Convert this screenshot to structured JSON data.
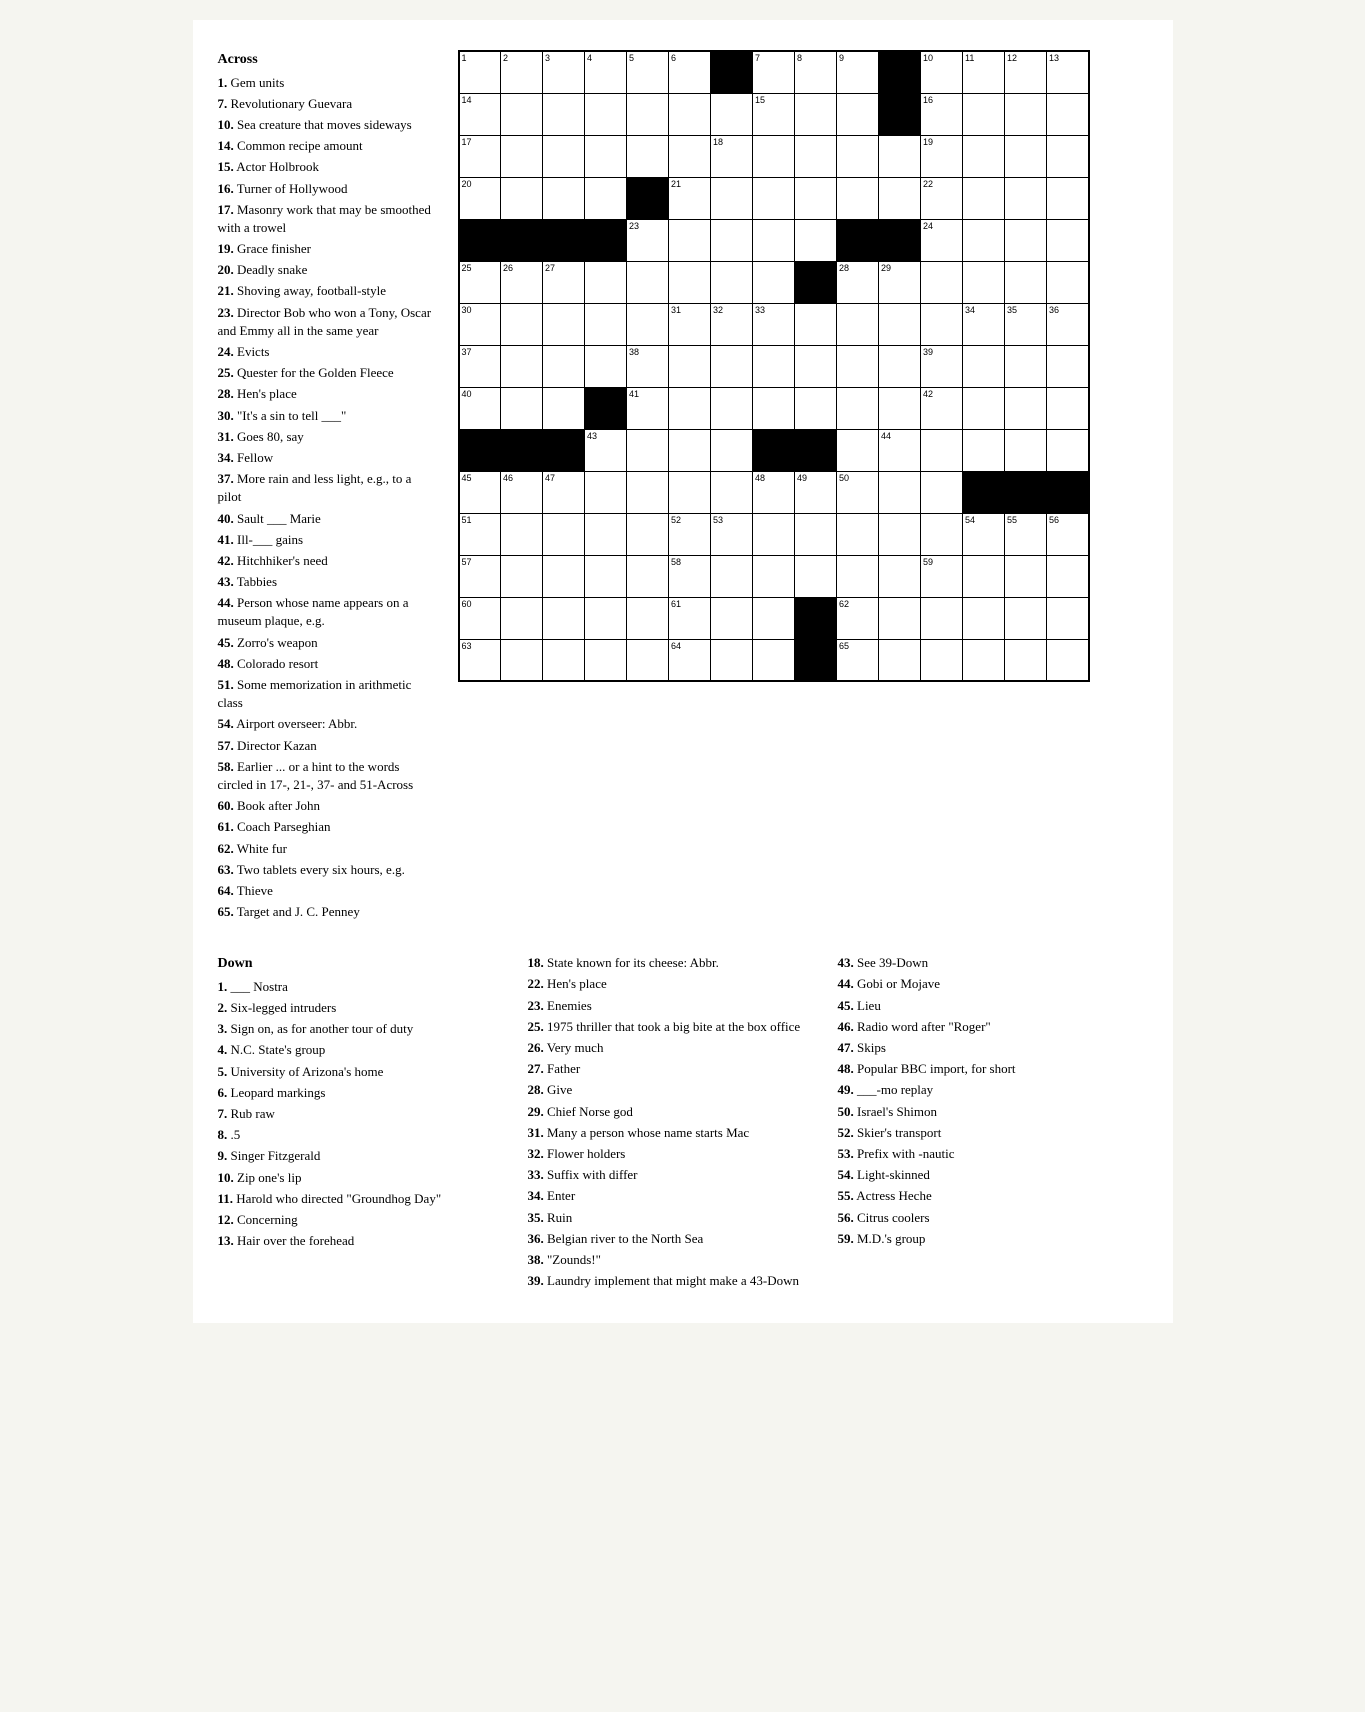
{
  "across_title": "Across",
  "down_title": "Down",
  "across_clues": [
    {
      "num": "1",
      "text": "Gem units"
    },
    {
      "num": "7",
      "text": "Revolutionary Guevara"
    },
    {
      "num": "10",
      "text": "Sea creature that moves sideways"
    },
    {
      "num": "14",
      "text": "Common recipe amount"
    },
    {
      "num": "15",
      "text": "Actor Holbrook"
    },
    {
      "num": "16",
      "text": "Turner of Hollywood"
    },
    {
      "num": "17",
      "text": "Masonry work that may be smoothed with a trowel"
    },
    {
      "num": "19",
      "text": "Grace finisher"
    },
    {
      "num": "20",
      "text": "Deadly snake"
    },
    {
      "num": "21",
      "text": "Shoving away, football-style"
    },
    {
      "num": "23",
      "text": "Director Bob who won a Tony, Oscar and Emmy all in the same year"
    },
    {
      "num": "24",
      "text": "Evicts"
    },
    {
      "num": "25",
      "text": "Quester for the Golden Fleece"
    },
    {
      "num": "28",
      "text": "Hen's place"
    },
    {
      "num": "30",
      "text": "\"It's a sin to tell ___\""
    },
    {
      "num": "31",
      "text": "Goes 80, say"
    },
    {
      "num": "34",
      "text": "Fellow"
    },
    {
      "num": "37",
      "text": "More rain and less light, e.g., to a pilot"
    },
    {
      "num": "40",
      "text": "Sault ___ Marie"
    },
    {
      "num": "41",
      "text": "Ill-___ gains"
    },
    {
      "num": "42",
      "text": "Hitchhiker's need"
    },
    {
      "num": "43",
      "text": "Tabbies"
    },
    {
      "num": "44",
      "text": "Person whose name appears on a museum plaque, e.g."
    },
    {
      "num": "45",
      "text": "Zorro's weapon"
    },
    {
      "num": "48",
      "text": "Colorado resort"
    },
    {
      "num": "51",
      "text": "Some memorization in arithmetic class"
    },
    {
      "num": "54",
      "text": "Airport overseer: Abbr."
    },
    {
      "num": "57",
      "text": "Director Kazan"
    },
    {
      "num": "58",
      "text": "Earlier ... or a hint to the words circled in 17-, 21-, 37- and 51-Across"
    },
    {
      "num": "60",
      "text": "Book after John"
    },
    {
      "num": "61",
      "text": "Coach Parseghian"
    },
    {
      "num": "62",
      "text": "White fur"
    },
    {
      "num": "63",
      "text": "Two tablets every six hours, e.g."
    },
    {
      "num": "64",
      "text": "Thieve"
    },
    {
      "num": "65",
      "text": "Target and J. C. Penney"
    }
  ],
  "down_col1_clues": [
    {
      "num": "1",
      "text": "___ Nostra"
    },
    {
      "num": "2",
      "text": "Six-legged intruders"
    },
    {
      "num": "3",
      "text": "Sign on, as for another tour of duty"
    },
    {
      "num": "4",
      "text": "N.C. State's group"
    },
    {
      "num": "5",
      "text": "University of Arizona's home"
    },
    {
      "num": "6",
      "text": "Leopard markings"
    },
    {
      "num": "7",
      "text": "Rub raw"
    },
    {
      "num": "8",
      "text": ".5"
    },
    {
      "num": "9",
      "text": "Singer Fitzgerald"
    },
    {
      "num": "10",
      "text": "Zip one's lip"
    },
    {
      "num": "11",
      "text": "Harold who directed \"Groundhog Day\""
    },
    {
      "num": "12",
      "text": "Concerning"
    },
    {
      "num": "13",
      "text": "Hair over the forehead"
    }
  ],
  "down_col2_clues": [
    {
      "num": "18",
      "text": "State known for its cheese: Abbr."
    },
    {
      "num": "22",
      "text": "Hen's place"
    },
    {
      "num": "23",
      "text": "Enemies"
    },
    {
      "num": "25",
      "text": "1975 thriller that took a big bite at the box office"
    },
    {
      "num": "26",
      "text": "Very much"
    },
    {
      "num": "27",
      "text": "Father"
    },
    {
      "num": "28",
      "text": "Give"
    },
    {
      "num": "29",
      "text": "Chief Norse god"
    },
    {
      "num": "31",
      "text": "Many a person whose name starts Mac"
    },
    {
      "num": "32",
      "text": "Flower holders"
    },
    {
      "num": "33",
      "text": "Suffix with differ"
    },
    {
      "num": "34",
      "text": "Enter"
    },
    {
      "num": "35",
      "text": "Ruin"
    },
    {
      "num": "36",
      "text": "Belgian river to the North Sea"
    },
    {
      "num": "38",
      "text": "\"Zounds!\""
    },
    {
      "num": "39",
      "text": "Laundry implement that might make a 43-Down"
    }
  ],
  "down_col3_clues": [
    {
      "num": "43",
      "text": "See 39-Down"
    },
    {
      "num": "44",
      "text": "Gobi or Mojave"
    },
    {
      "num": "45",
      "text": "Lieu"
    },
    {
      "num": "46",
      "text": "Radio word after \"Roger\""
    },
    {
      "num": "47",
      "text": "Skips"
    },
    {
      "num": "48",
      "text": "Popular BBC import, for short"
    },
    {
      "num": "49",
      "text": "___-mo replay"
    },
    {
      "num": "50",
      "text": "Israel's Shimon"
    },
    {
      "num": "52",
      "text": "Skier's transport"
    },
    {
      "num": "53",
      "text": "Prefix with -nautic"
    },
    {
      "num": "54",
      "text": "Light-skinned"
    },
    {
      "num": "55",
      "text": "Actress Heche"
    },
    {
      "num": "56",
      "text": "Citrus coolers"
    },
    {
      "num": "59",
      "text": "M.D.'s group"
    }
  ],
  "grid": {
    "rows": 15,
    "cols": 15,
    "cells": [
      [
        {
          "num": "1",
          "black": false
        },
        {
          "num": "2",
          "black": false
        },
        {
          "num": "3",
          "black": false
        },
        {
          "num": "4",
          "black": false
        },
        {
          "num": "5",
          "black": false
        },
        {
          "num": "6",
          "black": false
        },
        {
          "black": true
        },
        {
          "num": "7",
          "black": false
        },
        {
          "num": "8",
          "black": false
        },
        {
          "num": "9",
          "black": false
        },
        {
          "black": true
        },
        {
          "num": "10",
          "black": false
        },
        {
          "num": "11",
          "black": false
        },
        {
          "num": "12",
          "black": false
        },
        {
          "num": "13",
          "black": false
        }
      ],
      [
        {
          "num": "14",
          "black": false
        },
        {
          "black": false
        },
        {
          "black": false
        },
        {
          "black": false
        },
        {
          "black": false
        },
        {
          "black": false
        },
        {
          "black": false
        },
        {
          "num": "15",
          "black": false
        },
        {
          "black": false
        },
        {
          "black": false
        },
        {
          "black": true
        },
        {
          "num": "16",
          "black": false
        },
        {
          "black": false
        },
        {
          "black": false
        },
        {
          "black": false
        }
      ],
      [
        {
          "num": "17",
          "black": false
        },
        {
          "black": false
        },
        {
          "black": false
        },
        {
          "black": false
        },
        {
          "black": false
        },
        {
          "black": false
        },
        {
          "num": "18",
          "black": false
        },
        {
          "black": false
        },
        {
          "black": false
        },
        {
          "black": false
        },
        {
          "black": false
        },
        {
          "num": "19",
          "black": false
        },
        {
          "black": false
        },
        {
          "black": false
        },
        {
          "black": false
        }
      ],
      [
        {
          "num": "20",
          "black": false
        },
        {
          "black": false
        },
        {
          "black": false
        },
        {
          "black": false
        },
        {
          "black": true
        },
        {
          "num": "21",
          "black": false
        },
        {
          "black": false
        },
        {
          "black": false
        },
        {
          "black": false
        },
        {
          "black": false
        },
        {
          "black": false
        },
        {
          "num": "22",
          "black": false
        },
        {
          "black": false
        },
        {
          "black": false
        },
        {
          "black": false
        }
      ],
      [
        {
          "black": true
        },
        {
          "black": true
        },
        {
          "black": true
        },
        {
          "black": true
        },
        {
          "num": "23",
          "black": false
        },
        {
          "black": false
        },
        {
          "black": false
        },
        {
          "black": false
        },
        {
          "black": false
        },
        {
          "black": true
        },
        {
          "black": true
        },
        {
          "num": "24",
          "black": false
        },
        {
          "black": false
        },
        {
          "black": false
        },
        {
          "black": false
        }
      ],
      [
        {
          "num": "25",
          "black": false
        },
        {
          "num": "26",
          "black": false
        },
        {
          "num": "27",
          "black": false
        },
        {
          "black": false
        },
        {
          "black": false
        },
        {
          "black": false
        },
        {
          "black": false
        },
        {
          "black": false
        },
        {
          "black": true
        },
        {
          "num": "28",
          "black": false
        },
        {
          "num": "29",
          "black": false
        },
        {
          "black": false
        },
        {
          "black": false
        },
        {
          "black": false
        },
        {
          "black": false
        }
      ],
      [
        {
          "num": "30",
          "black": false
        },
        {
          "black": false
        },
        {
          "black": false
        },
        {
          "black": false
        },
        {
          "black": false
        },
        {
          "num": "31",
          "black": false
        },
        {
          "num": "32",
          "black": false
        },
        {
          "num": "33",
          "black": false
        },
        {
          "black": false
        },
        {
          "black": false
        },
        {
          "black": false
        },
        {
          "black": false
        },
        {
          "num": "34",
          "black": false
        },
        {
          "num": "35",
          "black": false
        },
        {
          "num": "36",
          "black": false
        }
      ],
      [
        {
          "num": "37",
          "black": false
        },
        {
          "black": false
        },
        {
          "black": false
        },
        {
          "black": false
        },
        {
          "num": "38",
          "black": false
        },
        {
          "black": false
        },
        {
          "black": false
        },
        {
          "black": false
        },
        {
          "black": false
        },
        {
          "black": false
        },
        {
          "black": false
        },
        {
          "num": "39",
          "black": false
        },
        {
          "black": false
        },
        {
          "black": false
        },
        {
          "black": false
        }
      ],
      [
        {
          "num": "40",
          "black": false
        },
        {
          "black": false
        },
        {
          "black": false
        },
        {
          "black": true
        },
        {
          "num": "41",
          "black": false
        },
        {
          "black": false
        },
        {
          "black": false
        },
        {
          "black": false
        },
        {
          "black": false
        },
        {
          "black": false
        },
        {
          "black": false
        },
        {
          "num": "42",
          "black": false
        },
        {
          "black": false
        },
        {
          "black": false
        },
        {
          "black": false
        }
      ],
      [
        {
          "black": true
        },
        {
          "black": true
        },
        {
          "black": true
        },
        {
          "num": "43",
          "black": false
        },
        {
          "black": false
        },
        {
          "black": false
        },
        {
          "black": false
        },
        {
          "black": true
        },
        {
          "black": true
        },
        {
          "black": false
        },
        {
          "num": "44",
          "black": false
        },
        {
          "black": false
        },
        {
          "black": false
        },
        {
          "black": false
        },
        {
          "black": false
        }
      ],
      [
        {
          "num": "45",
          "black": false
        },
        {
          "num": "46",
          "black": false
        },
        {
          "num": "47",
          "black": false
        },
        {
          "black": false
        },
        {
          "black": false
        },
        {
          "black": false
        },
        {
          "black": false
        },
        {
          "num": "48",
          "black": false
        },
        {
          "num": "49",
          "black": false
        },
        {
          "num": "50",
          "black": false
        },
        {
          "black": false
        },
        {
          "black": false
        },
        {
          "black": true
        },
        {
          "black": true
        },
        {
          "black": true
        }
      ],
      [
        {
          "num": "51",
          "black": false
        },
        {
          "black": false
        },
        {
          "black": false
        },
        {
          "black": false
        },
        {
          "black": false
        },
        {
          "num": "52",
          "black": false
        },
        {
          "num": "53",
          "black": false
        },
        {
          "black": false
        },
        {
          "black": false
        },
        {
          "black": false
        },
        {
          "black": false
        },
        {
          "black": false
        },
        {
          "num": "54",
          "black": false
        },
        {
          "num": "55",
          "black": false
        },
        {
          "num": "56",
          "black": false
        }
      ],
      [
        {
          "num": "57",
          "black": false
        },
        {
          "black": false
        },
        {
          "black": false
        },
        {
          "black": false
        },
        {
          "black": false
        },
        {
          "num": "58",
          "black": false
        },
        {
          "black": false
        },
        {
          "black": false
        },
        {
          "black": false
        },
        {
          "black": false
        },
        {
          "black": false
        },
        {
          "num": "59",
          "black": false
        },
        {
          "black": false
        },
        {
          "black": false
        },
        {
          "black": false
        }
      ],
      [
        {
          "num": "60",
          "black": false
        },
        {
          "black": false
        },
        {
          "black": false
        },
        {
          "black": false
        },
        {
          "black": false
        },
        {
          "num": "61",
          "black": false
        },
        {
          "black": false
        },
        {
          "black": false
        },
        {
          "black": true
        },
        {
          "num": "62",
          "black": false
        },
        {
          "black": false
        },
        {
          "black": false
        },
        {
          "black": false
        },
        {
          "black": false
        },
        {
          "black": false
        }
      ],
      [
        {
          "num": "63",
          "black": false
        },
        {
          "black": false
        },
        {
          "black": false
        },
        {
          "black": false
        },
        {
          "black": false
        },
        {
          "num": "64",
          "black": false
        },
        {
          "black": false
        },
        {
          "black": false
        },
        {
          "black": true
        },
        {
          "num": "65",
          "black": false
        },
        {
          "black": false
        },
        {
          "black": false
        },
        {
          "black": false
        },
        {
          "black": false
        },
        {
          "black": false
        }
      ]
    ]
  }
}
